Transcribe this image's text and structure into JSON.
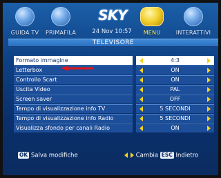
{
  "header": {
    "logo": "SKY",
    "datetime": "24 Nov 10:57",
    "nav": [
      {
        "label": "GUIDA TV"
      },
      {
        "label": "PRIMAFILA"
      },
      {
        "label": "MENU"
      },
      {
        "label": "INTERATTIVI"
      }
    ]
  },
  "title": "TELEVISORE",
  "settings": [
    {
      "label": "Formato immagine",
      "value": "4:3",
      "selected": true
    },
    {
      "label": "Letterbox",
      "value": "ON"
    },
    {
      "label": "Controllo Scart",
      "value": "ON"
    },
    {
      "label": "Uscita Video",
      "value": "PAL"
    },
    {
      "label": "Screen saver",
      "value": "OFF"
    },
    {
      "label": "Tempo di visualizzazione info TV",
      "value": "5 SECONDI"
    },
    {
      "label": "Tempo di visualizzazione info Radio",
      "value": "5 SECONDI"
    },
    {
      "label": "Visualizza sfondo per canali Radio",
      "value": "ON"
    }
  ],
  "footer": {
    "ok_key": "OK",
    "ok_label": "Salva modifiche",
    "change_label": "Cambia",
    "esc_key": "ESC",
    "esc_label": "Indietro"
  },
  "colors": {
    "accent": "#f4d21f",
    "background": "#0e3f82",
    "pointer": "#e0161b"
  }
}
